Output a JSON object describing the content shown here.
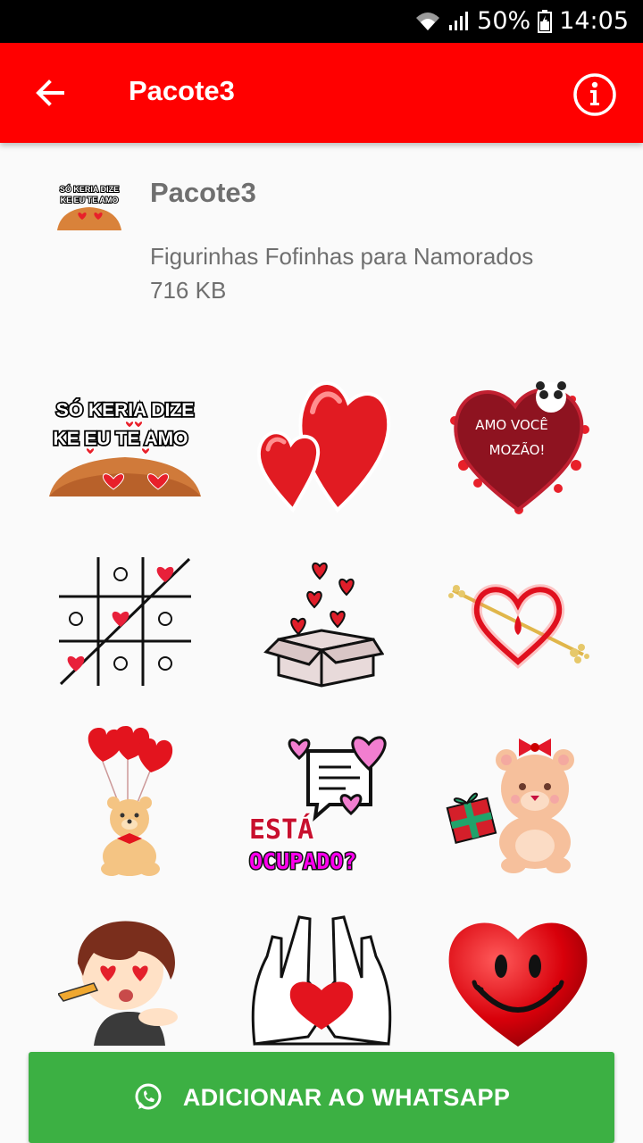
{
  "status_bar": {
    "battery": "50%",
    "time": "14:05",
    "icons": [
      "wifi-icon",
      "signal-icon",
      "battery-icon"
    ]
  },
  "app_bar": {
    "title": "Pacote3",
    "back_icon": "arrow-back-icon",
    "info_icon": "info-icon",
    "color": "#ff0000"
  },
  "pack": {
    "name": "Pacote3",
    "publisher": "Figurinhas Fofinhas para Namorados",
    "size": "716 KB",
    "tray_text_line1": "SÓ KERIA DIZE",
    "tray_text_line2": "KE EU TE AMO"
  },
  "stickers": [
    {
      "name": "sticker-keria-dize",
      "text1": "SÓ KERIA DIZE",
      "text2": "KE EU TE AMO"
    },
    {
      "name": "sticker-two-hearts"
    },
    {
      "name": "sticker-amo-voce-mozao",
      "text1": "AMO VOCÊ",
      "text2": "MOZÃO!"
    },
    {
      "name": "sticker-tic-tac-toe-hearts"
    },
    {
      "name": "sticker-box-of-hearts"
    },
    {
      "name": "sticker-heart-arrow"
    },
    {
      "name": "sticker-bear-balloons"
    },
    {
      "name": "sticker-esta-ocupado",
      "text1": "ESTÁ",
      "text2": "OCUPADO?"
    },
    {
      "name": "sticker-bear-gift"
    },
    {
      "name": "sticker-boy-heart-eyes"
    },
    {
      "name": "sticker-hands-heart"
    },
    {
      "name": "sticker-smiley-heart"
    }
  ],
  "add_button": {
    "label": "ADICIONAR AO WHATSAPP",
    "icon": "whatsapp-icon",
    "color": "#3cb043"
  }
}
